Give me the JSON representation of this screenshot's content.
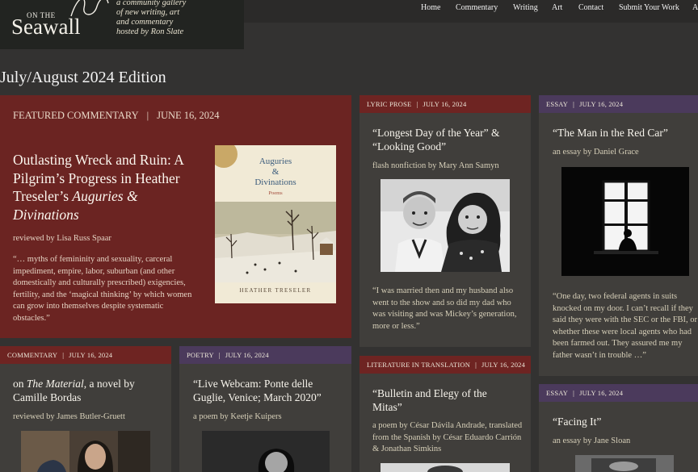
{
  "site": {
    "logo_on": "ON THE",
    "logo_name": "Seawall",
    "tagline": [
      "a community gallery",
      "of new writing, art",
      "and commentary",
      "hosted by Ron Slate"
    ]
  },
  "nav": [
    "Home",
    "Commentary",
    "Writing",
    "Art",
    "Contact",
    "Submit Your Work",
    "A"
  ],
  "edition": "July/August 2024 Edition",
  "featured": {
    "category": "FEATURED COMMENTARY",
    "date": "JUNE 16, 2024",
    "title_a": "Outlasting Wreck and Ruin: A Pilgrim’s Progress in Heather Treseler’s ",
    "title_b": "Auguries & Divinations",
    "byline": "reviewed by Lisa Russ Spaar",
    "quote": "“… myths of femininity and sexuality, carceral impediment, empire, labor, suburban (and other domestically and culturally prescribed) exigencies, fertility, and the ‘magical thinking’ by which women can grow into themselves despite systematic obstacles.”",
    "book": {
      "title_1": "Auguries",
      "title_2": "&",
      "title_3": "Divinations",
      "sub": "Poems",
      "author": "HEATHER TRESELER"
    }
  },
  "cards": {
    "lyric": {
      "category": "LYRIC PROSE",
      "date": "JULY 16, 2024",
      "title": "“Longest Day of the Year” & “Looking Good”",
      "byline": "flash nonfiction by Mary Ann Samyn",
      "quote": "“I was married then and my husband also went to the show and so did my dad who was visiting and was Mickey’s generation, more or less.”"
    },
    "essay1": {
      "category": "ESSAY",
      "date": "JULY 16, 2024",
      "title": "“The Man in the Red Car”",
      "byline": "an essay by Daniel Grace",
      "quote": "“One day, two federal agents in suits knocked on my door. I can’t recall if they said they were with the SEC or the FBI, or whether these were local agents who had been farmed out. They assured me my father wasn’t in trouble …”"
    },
    "commentary": {
      "category": "COMMENTARY",
      "date": "JULY 16, 2024",
      "title_pre": "on ",
      "title_em": "The Material",
      "title_post": ", a novel by Camille Bordas",
      "byline": "reviewed by James Butler-Gruett"
    },
    "poetry": {
      "category": "POETRY",
      "date": "JULY 16, 2024",
      "title": "“Live Webcam: Ponte delle Guglie, Venice; March 2020”",
      "byline": "a poem by Keetje Kuipers"
    },
    "translation": {
      "category": "LITERATURE IN TRANSLATION",
      "date": "JULY 16, 2024",
      "title": "“Bulletin and Elegy of the Mitas”",
      "byline": "a poem by César Dávila Andrade, translated from the Spanish by César Eduardo Carrión & Jonathan Simkins"
    },
    "essay2": {
      "category": "ESSAY",
      "date": "JULY 16, 2024",
      "title": "“Facing It”",
      "byline": "an essay by Jane Sloan"
    }
  },
  "colors": {
    "background": "#333231",
    "featured": "#6b2422",
    "red_label": "#6e2422",
    "purple_label": "#4b3a5c",
    "card": "#403e3b"
  }
}
